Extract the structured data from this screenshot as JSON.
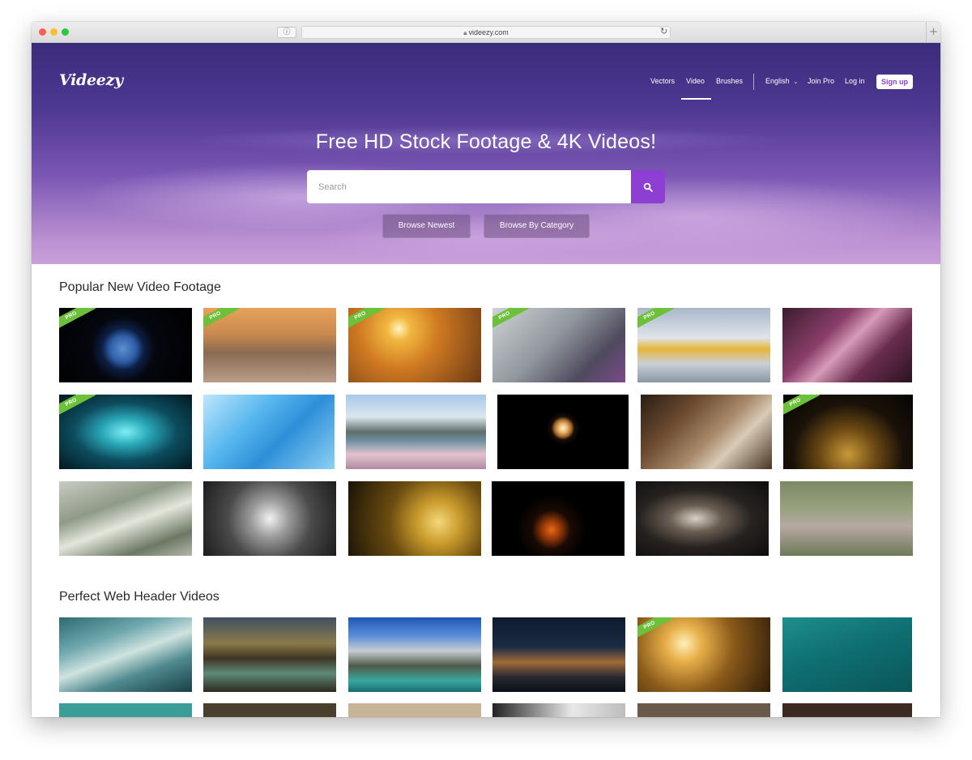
{
  "browser": {
    "url": "videezy.com"
  },
  "brand": {
    "logo": "Videezy"
  },
  "nav": {
    "vectors": "Vectors",
    "video": "Video",
    "brushes": "Brushes",
    "language": "English",
    "join_pro": "Join Pro",
    "login": "Log in",
    "signup": "Sign up"
  },
  "hero": {
    "title": "Free HD Stock Footage & 4K Videos!",
    "search_placeholder": "Search",
    "browse_newest": "Browse Newest",
    "browse_category": "Browse By Category"
  },
  "sections": {
    "popular": {
      "title": "Popular New Video Footage"
    },
    "web_header": {
      "title": "Perfect Web Header Videos"
    }
  },
  "badge": {
    "pro": "PRO"
  },
  "colors": {
    "accent": "#8d3fd4",
    "pro_badge": "#6cc03a",
    "hero_top": "#3c2c7c",
    "hero_bottom": "#c9a0da"
  },
  "thumbnails": {
    "popular": [
      {
        "subject": "earth from space",
        "pro": true
      },
      {
        "subject": "woman walking in surf",
        "pro": true
      },
      {
        "subject": "surfer at sunset",
        "pro": true
      },
      {
        "subject": "laboratory",
        "pro": true
      },
      {
        "subject": "robotic arm",
        "pro": true
      },
      {
        "subject": "cubes",
        "pro": false
      },
      {
        "subject": "sci-fi tunnel",
        "pro": true
      },
      {
        "subject": "blue polygons",
        "pro": false
      },
      {
        "subject": "bridge and blossoms",
        "pro": false
      },
      {
        "subject": "firework burst",
        "pro": false
      },
      {
        "subject": "baseball and glove",
        "pro": false
      },
      {
        "subject": "golden particles",
        "pro": true
      },
      {
        "subject": "dollar bills",
        "pro": false
      },
      {
        "subject": "metal bubbles",
        "pro": false
      },
      {
        "subject": "bitcoins",
        "pro": false
      },
      {
        "subject": "oranges",
        "pro": false
      },
      {
        "subject": "splash",
        "pro": false
      },
      {
        "subject": "hippos",
        "pro": false
      }
    ],
    "web_header": [
      {
        "subject": "flowing water",
        "pro": false
      },
      {
        "subject": "wooden pier",
        "pro": false
      },
      {
        "subject": "mountain lake",
        "pro": false
      },
      {
        "subject": "city skyline at night",
        "pro": false
      },
      {
        "subject": "hand in water",
        "pro": true
      },
      {
        "subject": "boats aerial",
        "pro": false
      }
    ]
  }
}
